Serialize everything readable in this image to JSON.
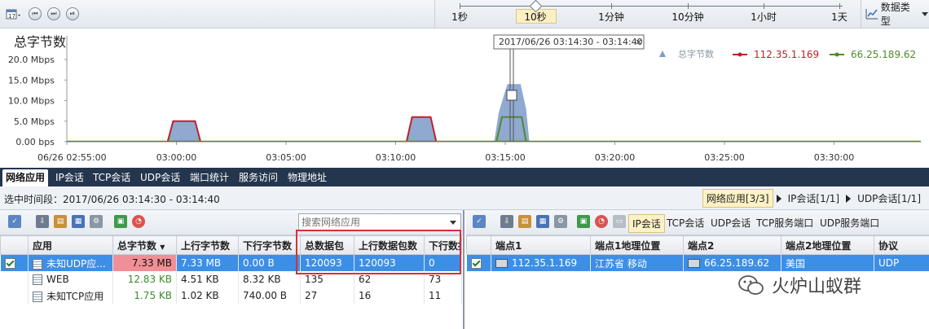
{
  "toolbar": {
    "icons": [
      "calendar-icon",
      "skip-back-icon",
      "skip-forward-icon",
      "play-pause-icon"
    ],
    "scale_labels": [
      "1秒",
      "10秒",
      "1分钟",
      "10分钟",
      "1小时",
      "1天"
    ],
    "scale_selected": "10秒",
    "data_type_label": "数据类型"
  },
  "chart": {
    "title": "总字节数",
    "tooltip": "2017/06/26  03:14:30 - 03:14:40",
    "legend": [
      "总字节数",
      "112.35.1.169",
      "66.25.189.62"
    ]
  },
  "chart_data": {
    "type": "area",
    "title": "总字节数",
    "ylim": [
      0,
      20
    ],
    "y_ticks": [
      "0.00 bps",
      "5.0 Mbps",
      "10.0 Mbps",
      "15.0 Mbps",
      "20.0 Mbps"
    ],
    "x_ticks": [
      "06/26 02:55:00",
      "03:00:00",
      "03:05:00",
      "03:10:00",
      "03:15:00",
      "03:20:00",
      "03:25:00",
      "03:30:00"
    ],
    "x_minutes": [
      0,
      5,
      10,
      15,
      20,
      25,
      30,
      35
    ],
    "series": [
      {
        "name": "总字节数",
        "color": "#7d9ac9",
        "x": [
          0,
          4.7,
          4.95,
          5.8,
          6.05,
          20,
          40
        ],
        "y": [
          0,
          0,
          5.0,
          5.0,
          0,
          0,
          0
        ],
        "peaks": [
          {
            "x": [
              4.6,
              4.85,
              5.85,
              6.1
            ],
            "y": [
              0,
              5.1,
              5.1,
              0
            ]
          },
          {
            "x": [
              15.5,
              15.75,
              16.6,
              16.85
            ],
            "y": [
              0,
              6.1,
              6.1,
              0
            ]
          },
          {
            "x": [
              19.5,
              19.7,
              19.95,
              20.1,
              20.7,
              20.95,
              21.1
            ],
            "y": [
              0,
              7.0,
              11.5,
              14.0,
              14.0,
              8.0,
              0
            ]
          }
        ]
      },
      {
        "name": "112.35.1.169",
        "color": "#c0202a",
        "peaks": [
          {
            "x": [
              4.6,
              4.85,
              5.85,
              6.1
            ],
            "y": [
              0,
              5.0,
              5.0,
              0
            ]
          },
          {
            "x": [
              15.5,
              15.75,
              16.6,
              16.85
            ],
            "y": [
              0,
              6.0,
              6.0,
              0
            ]
          }
        ]
      },
      {
        "name": "66.25.189.62",
        "color": "#4e8a2c",
        "peaks": [
          {
            "x": [
              19.6,
              19.85,
              20.75,
              20.95
            ],
            "y": [
              0,
              6.0,
              6.0,
              0
            ]
          }
        ]
      }
    ],
    "cursor_minute": 20.0,
    "grid": false,
    "legend": "top-right"
  },
  "tabs": [
    {
      "label": "网络应用",
      "active": true
    },
    {
      "label": "IP会话"
    },
    {
      "label": "TCP会话"
    },
    {
      "label": "UDP会话"
    },
    {
      "label": "端口统计"
    },
    {
      "label": "服务访问"
    },
    {
      "label": "物理地址"
    }
  ],
  "selection": {
    "text": "选中时间段：2017/06/26  03:14:30 - 03:14:40"
  },
  "breadcrumb": [
    {
      "label": "网络应用[3/3]",
      "current": true
    },
    {
      "label": "IP会话[1/1]"
    },
    {
      "label": "UDP会话[1/1]"
    }
  ],
  "left_panel": {
    "search_placeholder": "搜索网络应用",
    "columns": [
      "应用",
      "总字节数",
      "上行字节数",
      "下行字节数",
      "总数据包",
      "上行数据包数",
      "下行数据"
    ],
    "rows": [
      {
        "app": "未知UDP应...",
        "total": "7.33 MB",
        "up": "7.33 MB",
        "down": "0.00 B",
        "pk": "120093",
        "uppk": "120093",
        "downpk": "0",
        "selected": true
      },
      {
        "app": "WEB",
        "total": "12.83 KB",
        "up": "4.51 KB",
        "down": "8.32 KB",
        "pk": "135",
        "uppk": "62",
        "downpk": "73"
      },
      {
        "app": "未知TCP应用",
        "total": "1.75 KB",
        "up": "1.02 KB",
        "down": "740.00 B",
        "pk": "27",
        "uppk": "16",
        "downpk": "11"
      }
    ]
  },
  "right_panel": {
    "tabs": [
      "IP会话",
      "TCP会话",
      "UDP会话",
      "TCP服务端口",
      "UDP服务端口"
    ],
    "columns": [
      "端点1",
      "端点1地理位置",
      "端点2",
      "端点2地理位置",
      "协议"
    ],
    "rows": [
      {
        "ep1": "112.35.1.169",
        "geo1": "江苏省 移动",
        "ep2": "66.25.189.62",
        "geo2": "美国",
        "proto": "UDP",
        "selected": true
      }
    ]
  },
  "watermark": "火炉山蚁群",
  "colors": {
    "tabbar": "#24364d",
    "selected_row": "#3d8ee6",
    "highlight_box": "#d6303a",
    "bytes_bar": "#f08f95"
  }
}
